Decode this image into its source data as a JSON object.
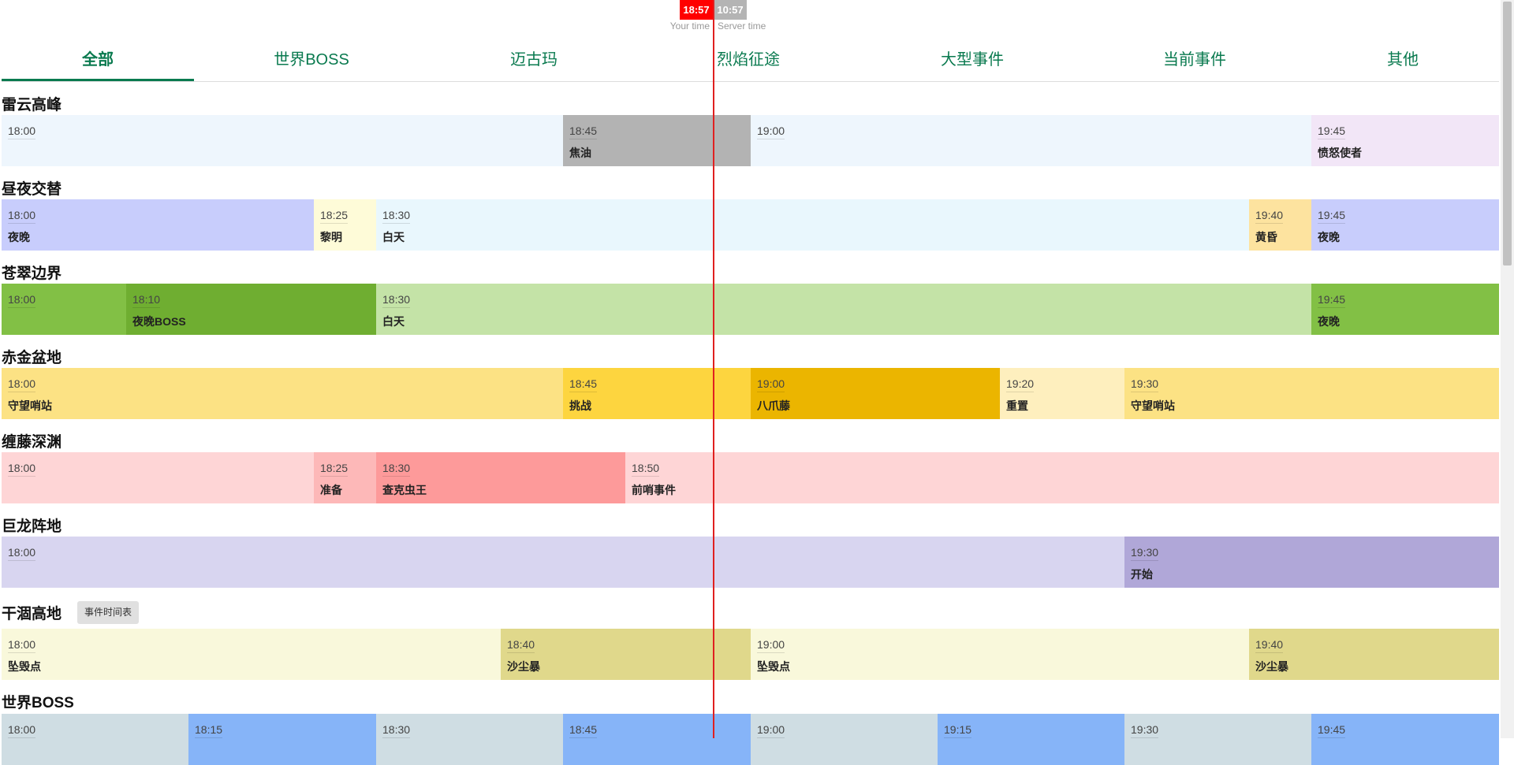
{
  "clock": {
    "your_time": "18:57",
    "server_time": "10:57",
    "your_label": "Your time",
    "server_label": "Server time"
  },
  "tabs": [
    {
      "label": "全部"
    },
    {
      "label": "世界BOSS"
    },
    {
      "label": "迈古玛"
    },
    {
      "label": "烈焰征途"
    },
    {
      "label": "大型事件"
    },
    {
      "label": "当前事件"
    },
    {
      "label": "其他"
    }
  ],
  "zones": [
    {
      "title": "雷云高峰",
      "segments": [
        {
          "time": "18:00",
          "name": "",
          "color": "#eef6fd"
        },
        {
          "time": "18:45",
          "name": "焦油",
          "color": "#b3b3b3"
        },
        {
          "time": "19:00",
          "name": "",
          "color": "#eef6fd"
        },
        {
          "time": "19:45",
          "name": "愤怒使者",
          "color": "#f2e6f7"
        }
      ]
    },
    {
      "title": "昼夜交替",
      "segments": [
        {
          "time": "18:00",
          "name": "夜晚",
          "color": "#c8cdfc"
        },
        {
          "time": "18:25",
          "name": "黎明",
          "color": "#fefbd8"
        },
        {
          "time": "18:30",
          "name": "白天",
          "color": "#e9f7fd"
        },
        {
          "time": "19:40",
          "name": "黄昏",
          "color": "#fde39f"
        },
        {
          "time": "19:45",
          "name": "夜晚",
          "color": "#c8cdfc"
        }
      ]
    },
    {
      "title": "苍翠边界",
      "segments": [
        {
          "time": "18:00",
          "name": "",
          "color": "#82c045"
        },
        {
          "time": "18:10",
          "name": "夜晚BOSS",
          "color": "#6fae31"
        },
        {
          "time": "18:30",
          "name": "白天",
          "color": "#c4e3a7"
        },
        {
          "time": "19:45",
          "name": "夜晚",
          "color": "#82c045"
        }
      ]
    },
    {
      "title": "赤金盆地",
      "segments": [
        {
          "time": "18:00",
          "name": "守望哨站",
          "color": "#fce284"
        },
        {
          "time": "18:45",
          "name": "挑战",
          "color": "#fdd53f"
        },
        {
          "time": "19:00",
          "name": "八爪藤",
          "color": "#ebb500"
        },
        {
          "time": "19:20",
          "name": "重置",
          "color": "#feefbe"
        },
        {
          "time": "19:30",
          "name": "守望哨站",
          "color": "#fce284"
        }
      ]
    },
    {
      "title": "缠藤深渊",
      "segments": [
        {
          "time": "18:00",
          "name": "",
          "color": "#fed5d6"
        },
        {
          "time": "18:25",
          "name": "准备",
          "color": "#fdb8b8"
        },
        {
          "time": "18:30",
          "name": "查克虫王",
          "color": "#fd9a9a"
        },
        {
          "time": "18:50",
          "name": "前哨事件",
          "color": "#fed5d6"
        }
      ]
    },
    {
      "title": "巨龙阵地",
      "button": "",
      "segments": [
        {
          "time": "18:00",
          "name": "",
          "color": "#d8d5f0"
        },
        {
          "time": "19:30",
          "name": "开始",
          "color": "#b0a7d8"
        }
      ]
    },
    {
      "title": "干涸高地",
      "button": "事件时间表",
      "segments": [
        {
          "time": "18:00",
          "name": "坠毁点",
          "color": "#f9f8db"
        },
        {
          "time": "18:40",
          "name": "沙尘暴",
          "color": "#e0d88b"
        },
        {
          "time": "19:00",
          "name": "坠毁点",
          "color": "#f9f8db"
        },
        {
          "time": "19:40",
          "name": "沙尘暴",
          "color": "#e0d88b"
        }
      ]
    },
    {
      "title": "世界BOSS",
      "segments": [
        {
          "time": "18:00",
          "name": "",
          "color": "#cfdde3"
        },
        {
          "time": "18:15",
          "name": "",
          "color": "#86b4f8"
        },
        {
          "time": "18:30",
          "name": "",
          "color": "#cfdde3"
        },
        {
          "time": "18:45",
          "name": "",
          "color": "#86b4f8"
        },
        {
          "time": "19:00",
          "name": "",
          "color": "#cfdde3"
        },
        {
          "time": "19:15",
          "name": "",
          "color": "#86b4f8"
        },
        {
          "time": "19:30",
          "name": "",
          "color": "#cfdde3"
        },
        {
          "time": "19:45",
          "name": "",
          "color": "#86b4f8"
        }
      ]
    }
  ]
}
